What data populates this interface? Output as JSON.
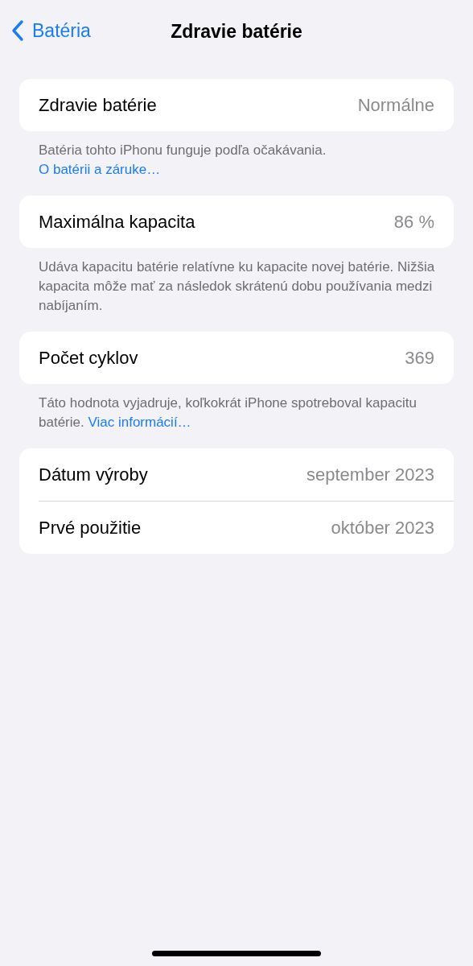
{
  "nav": {
    "back": "Batéria",
    "title": "Zdravie batérie"
  },
  "sections": [
    {
      "rows": [
        {
          "label": "Zdravie batérie",
          "value": "Normálne"
        }
      ],
      "footer": {
        "text": "Batéria tohto iPhonu funguje podľa očakávania.",
        "link": "O batérii a záruke…"
      }
    },
    {
      "rows": [
        {
          "label": "Maximálna kapacita",
          "value": "86 %"
        }
      ],
      "footer": {
        "text": "Udáva kapacitu batérie relatívne ku kapacite novej batérie. Nižšia kapacita môže mať za následok skrátenú dobu používania medzi nabíjaním."
      }
    },
    {
      "rows": [
        {
          "label": "Počet cyklov",
          "value": "369"
        }
      ],
      "footer": {
        "text": "Táto hodnota vyjadruje, koľkokrát iPhone spotreboval kapacitu batérie.",
        "link": "Viac informácií…"
      }
    },
    {
      "rows": [
        {
          "label": "Dátum výroby",
          "value": "september 2023"
        },
        {
          "label": "Prvé použitie",
          "value": "október 2023"
        }
      ]
    }
  ]
}
